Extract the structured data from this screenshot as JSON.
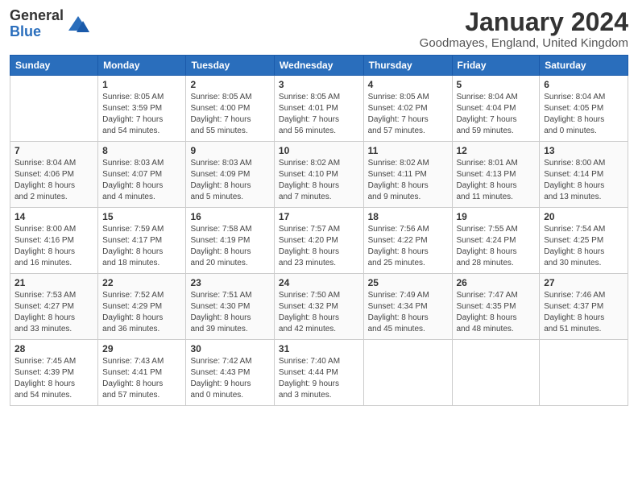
{
  "header": {
    "logo_general": "General",
    "logo_blue": "Blue",
    "month_title": "January 2024",
    "location": "Goodmayes, England, United Kingdom"
  },
  "days_of_week": [
    "Sunday",
    "Monday",
    "Tuesday",
    "Wednesday",
    "Thursday",
    "Friday",
    "Saturday"
  ],
  "weeks": [
    [
      {
        "day": "",
        "info": ""
      },
      {
        "day": "1",
        "info": "Sunrise: 8:05 AM\nSunset: 3:59 PM\nDaylight: 7 hours\nand 54 minutes."
      },
      {
        "day": "2",
        "info": "Sunrise: 8:05 AM\nSunset: 4:00 PM\nDaylight: 7 hours\nand 55 minutes."
      },
      {
        "day": "3",
        "info": "Sunrise: 8:05 AM\nSunset: 4:01 PM\nDaylight: 7 hours\nand 56 minutes."
      },
      {
        "day": "4",
        "info": "Sunrise: 8:05 AM\nSunset: 4:02 PM\nDaylight: 7 hours\nand 57 minutes."
      },
      {
        "day": "5",
        "info": "Sunrise: 8:04 AM\nSunset: 4:04 PM\nDaylight: 7 hours\nand 59 minutes."
      },
      {
        "day": "6",
        "info": "Sunrise: 8:04 AM\nSunset: 4:05 PM\nDaylight: 8 hours\nand 0 minutes."
      }
    ],
    [
      {
        "day": "7",
        "info": "Sunrise: 8:04 AM\nSunset: 4:06 PM\nDaylight: 8 hours\nand 2 minutes."
      },
      {
        "day": "8",
        "info": "Sunrise: 8:03 AM\nSunset: 4:07 PM\nDaylight: 8 hours\nand 4 minutes."
      },
      {
        "day": "9",
        "info": "Sunrise: 8:03 AM\nSunset: 4:09 PM\nDaylight: 8 hours\nand 5 minutes."
      },
      {
        "day": "10",
        "info": "Sunrise: 8:02 AM\nSunset: 4:10 PM\nDaylight: 8 hours\nand 7 minutes."
      },
      {
        "day": "11",
        "info": "Sunrise: 8:02 AM\nSunset: 4:11 PM\nDaylight: 8 hours\nand 9 minutes."
      },
      {
        "day": "12",
        "info": "Sunrise: 8:01 AM\nSunset: 4:13 PM\nDaylight: 8 hours\nand 11 minutes."
      },
      {
        "day": "13",
        "info": "Sunrise: 8:00 AM\nSunset: 4:14 PM\nDaylight: 8 hours\nand 13 minutes."
      }
    ],
    [
      {
        "day": "14",
        "info": "Sunrise: 8:00 AM\nSunset: 4:16 PM\nDaylight: 8 hours\nand 16 minutes."
      },
      {
        "day": "15",
        "info": "Sunrise: 7:59 AM\nSunset: 4:17 PM\nDaylight: 8 hours\nand 18 minutes."
      },
      {
        "day": "16",
        "info": "Sunrise: 7:58 AM\nSunset: 4:19 PM\nDaylight: 8 hours\nand 20 minutes."
      },
      {
        "day": "17",
        "info": "Sunrise: 7:57 AM\nSunset: 4:20 PM\nDaylight: 8 hours\nand 23 minutes."
      },
      {
        "day": "18",
        "info": "Sunrise: 7:56 AM\nSunset: 4:22 PM\nDaylight: 8 hours\nand 25 minutes."
      },
      {
        "day": "19",
        "info": "Sunrise: 7:55 AM\nSunset: 4:24 PM\nDaylight: 8 hours\nand 28 minutes."
      },
      {
        "day": "20",
        "info": "Sunrise: 7:54 AM\nSunset: 4:25 PM\nDaylight: 8 hours\nand 30 minutes."
      }
    ],
    [
      {
        "day": "21",
        "info": "Sunrise: 7:53 AM\nSunset: 4:27 PM\nDaylight: 8 hours\nand 33 minutes."
      },
      {
        "day": "22",
        "info": "Sunrise: 7:52 AM\nSunset: 4:29 PM\nDaylight: 8 hours\nand 36 minutes."
      },
      {
        "day": "23",
        "info": "Sunrise: 7:51 AM\nSunset: 4:30 PM\nDaylight: 8 hours\nand 39 minutes."
      },
      {
        "day": "24",
        "info": "Sunrise: 7:50 AM\nSunset: 4:32 PM\nDaylight: 8 hours\nand 42 minutes."
      },
      {
        "day": "25",
        "info": "Sunrise: 7:49 AM\nSunset: 4:34 PM\nDaylight: 8 hours\nand 45 minutes."
      },
      {
        "day": "26",
        "info": "Sunrise: 7:47 AM\nSunset: 4:35 PM\nDaylight: 8 hours\nand 48 minutes."
      },
      {
        "day": "27",
        "info": "Sunrise: 7:46 AM\nSunset: 4:37 PM\nDaylight: 8 hours\nand 51 minutes."
      }
    ],
    [
      {
        "day": "28",
        "info": "Sunrise: 7:45 AM\nSunset: 4:39 PM\nDaylight: 8 hours\nand 54 minutes."
      },
      {
        "day": "29",
        "info": "Sunrise: 7:43 AM\nSunset: 4:41 PM\nDaylight: 8 hours\nand 57 minutes."
      },
      {
        "day": "30",
        "info": "Sunrise: 7:42 AM\nSunset: 4:43 PM\nDaylight: 9 hours\nand 0 minutes."
      },
      {
        "day": "31",
        "info": "Sunrise: 7:40 AM\nSunset: 4:44 PM\nDaylight: 9 hours\nand 3 minutes."
      },
      {
        "day": "",
        "info": ""
      },
      {
        "day": "",
        "info": ""
      },
      {
        "day": "",
        "info": ""
      }
    ]
  ]
}
